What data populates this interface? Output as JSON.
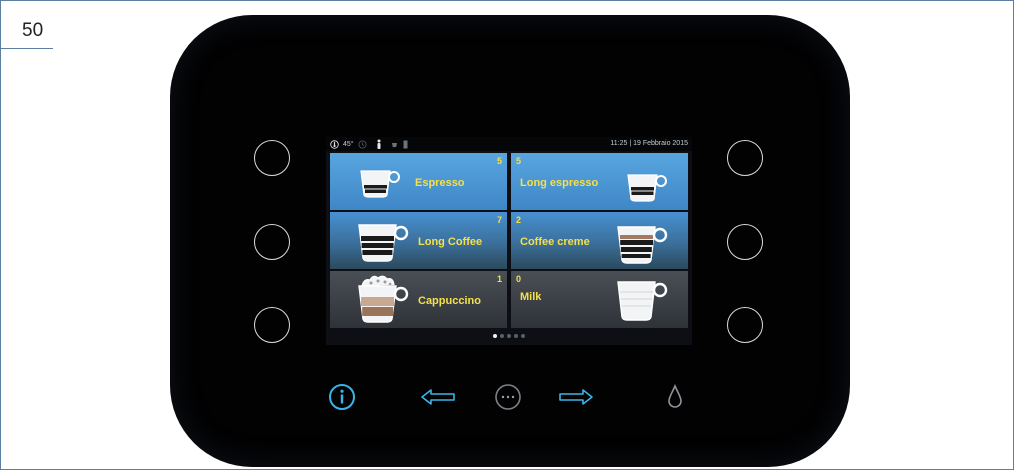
{
  "page": {
    "number": "50"
  },
  "status": {
    "temperature": "45°",
    "datetime": "11:25 | 19 Febbraio 2015"
  },
  "beverages": [
    {
      "label": "Espresso",
      "count": "5",
      "cup": "espresso"
    },
    {
      "label": "Long espresso",
      "count": "5",
      "cup": "espresso"
    },
    {
      "label": "Long Coffee",
      "count": "7",
      "cup": "long-coffee"
    },
    {
      "label": "Coffee creme",
      "count": "2",
      "cup": "coffee-creme"
    },
    {
      "label": "Cappuccino",
      "count": "1",
      "cup": "cappuccino"
    },
    {
      "label": "Milk",
      "count": "0",
      "cup": "milk"
    }
  ],
  "pagination": {
    "pages": 5,
    "current": 1
  },
  "icons": {
    "info": "info-icon",
    "prev": "arrow-left-icon",
    "more": "more-icon",
    "next": "arrow-right-icon",
    "water": "water-drop-icon"
  },
  "colors": {
    "accent": "#3ab4e6",
    "label": "#f4e04a",
    "tile_top": "#58a6e0"
  }
}
